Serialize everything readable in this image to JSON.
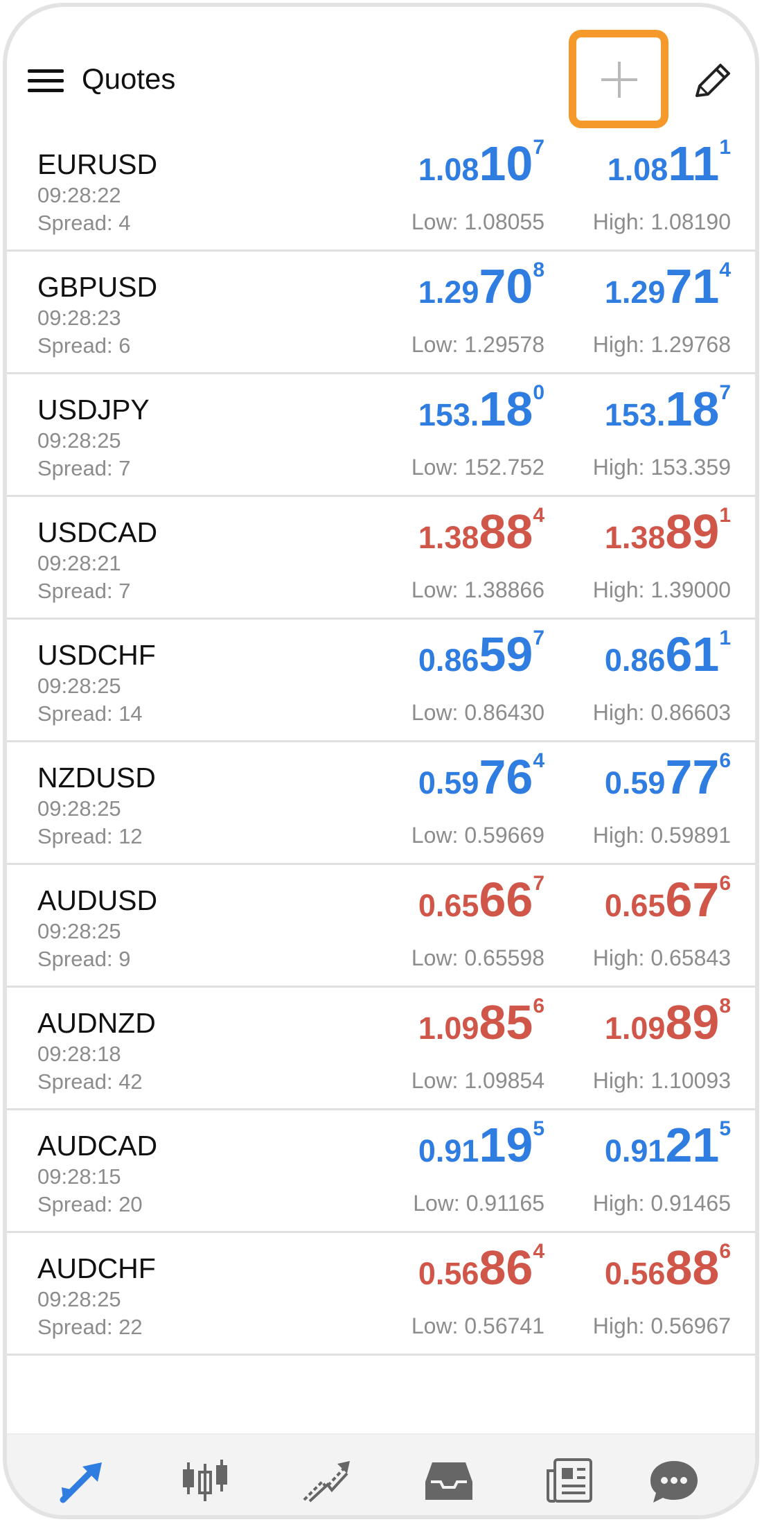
{
  "header": {
    "title": "Quotes",
    "menu_icon": "hamburger-menu-icon",
    "add_icon": "plus-icon",
    "edit_icon": "pencil-icon",
    "highlight_color": "#f5992a"
  },
  "colors": {
    "up": "#2f7de1",
    "down": "#d1564a"
  },
  "quotes": [
    {
      "symbol": "EURUSD",
      "time": "09:28:22",
      "spread": "Spread: 4",
      "color": "blue",
      "bid": {
        "p1": "1.08",
        "p2": "10",
        "p3": "7"
      },
      "ask": {
        "p1": "1.08",
        "p2": "11",
        "p3": "1"
      },
      "low": "Low: 1.08055",
      "high": "High: 1.08190"
    },
    {
      "symbol": "GBPUSD",
      "time": "09:28:23",
      "spread": "Spread: 6",
      "color": "blue",
      "bid": {
        "p1": "1.29",
        "p2": "70",
        "p3": "8"
      },
      "ask": {
        "p1": "1.29",
        "p2": "71",
        "p3": "4"
      },
      "low": "Low: 1.29578",
      "high": "High: 1.29768"
    },
    {
      "symbol": "USDJPY",
      "time": "09:28:25",
      "spread": "Spread: 7",
      "color": "blue",
      "bid": {
        "p1": "153.",
        "p2": "18",
        "p3": "0"
      },
      "ask": {
        "p1": "153.",
        "p2": "18",
        "p3": "7"
      },
      "low": "Low: 152.752",
      "high": "High: 153.359"
    },
    {
      "symbol": "USDCAD",
      "time": "09:28:21",
      "spread": "Spread: 7",
      "color": "red",
      "bid": {
        "p1": "1.38",
        "p2": "88",
        "p3": "4"
      },
      "ask": {
        "p1": "1.38",
        "p2": "89",
        "p3": "1"
      },
      "low": "Low: 1.38866",
      "high": "High: 1.39000"
    },
    {
      "symbol": "USDCHF",
      "time": "09:28:25",
      "spread": "Spread: 14",
      "color": "blue",
      "bid": {
        "p1": "0.86",
        "p2": "59",
        "p3": "7"
      },
      "ask": {
        "p1": "0.86",
        "p2": "61",
        "p3": "1"
      },
      "low": "Low: 0.86430",
      "high": "High: 0.86603"
    },
    {
      "symbol": "NZDUSD",
      "time": "09:28:25",
      "spread": "Spread: 12",
      "color": "blue",
      "bid": {
        "p1": "0.59",
        "p2": "76",
        "p3": "4"
      },
      "ask": {
        "p1": "0.59",
        "p2": "77",
        "p3": "6"
      },
      "low": "Low: 0.59669",
      "high": "High: 0.59891"
    },
    {
      "symbol": "AUDUSD",
      "time": "09:28:25",
      "spread": "Spread: 9",
      "color": "red",
      "bid": {
        "p1": "0.65",
        "p2": "66",
        "p3": "7"
      },
      "ask": {
        "p1": "0.65",
        "p2": "67",
        "p3": "6"
      },
      "low": "Low: 0.65598",
      "high": "High: 0.65843"
    },
    {
      "symbol": "AUDNZD",
      "time": "09:28:18",
      "spread": "Spread: 42",
      "color": "red",
      "bid": {
        "p1": "1.09",
        "p2": "85",
        "p3": "6"
      },
      "ask": {
        "p1": "1.09",
        "p2": "89",
        "p3": "8"
      },
      "low": "Low: 1.09854",
      "high": "High: 1.10093"
    },
    {
      "symbol": "AUDCAD",
      "time": "09:28:15",
      "spread": "Spread: 20",
      "color": "blue",
      "bid": {
        "p1": "0.91",
        "p2": "19",
        "p3": "5"
      },
      "ask": {
        "p1": "0.91",
        "p2": "21",
        "p3": "5"
      },
      "low": "Low: 0.91165",
      "high": "High: 0.91465"
    },
    {
      "symbol": "AUDCHF",
      "time": "09:28:25",
      "spread": "Spread: 22",
      "color": "red",
      "bid": {
        "p1": "0.56",
        "p2": "86",
        "p3": "4"
      },
      "ask": {
        "p1": "0.56",
        "p2": "88",
        "p3": "6"
      },
      "low": "Low: 0.56741",
      "high": "High: 0.56967"
    }
  ],
  "nav": {
    "items": [
      {
        "icon": "quotes-arrows-icon",
        "active": true
      },
      {
        "icon": "chart-candles-icon",
        "active": false
      },
      {
        "icon": "trade-icon",
        "active": false
      },
      {
        "icon": "history-inbox-icon",
        "active": false
      },
      {
        "icon": "news-icon",
        "active": false
      },
      {
        "icon": "chat-icon",
        "active": false
      }
    ],
    "active_color": "#2f7de1",
    "inactive_color": "#666666"
  }
}
